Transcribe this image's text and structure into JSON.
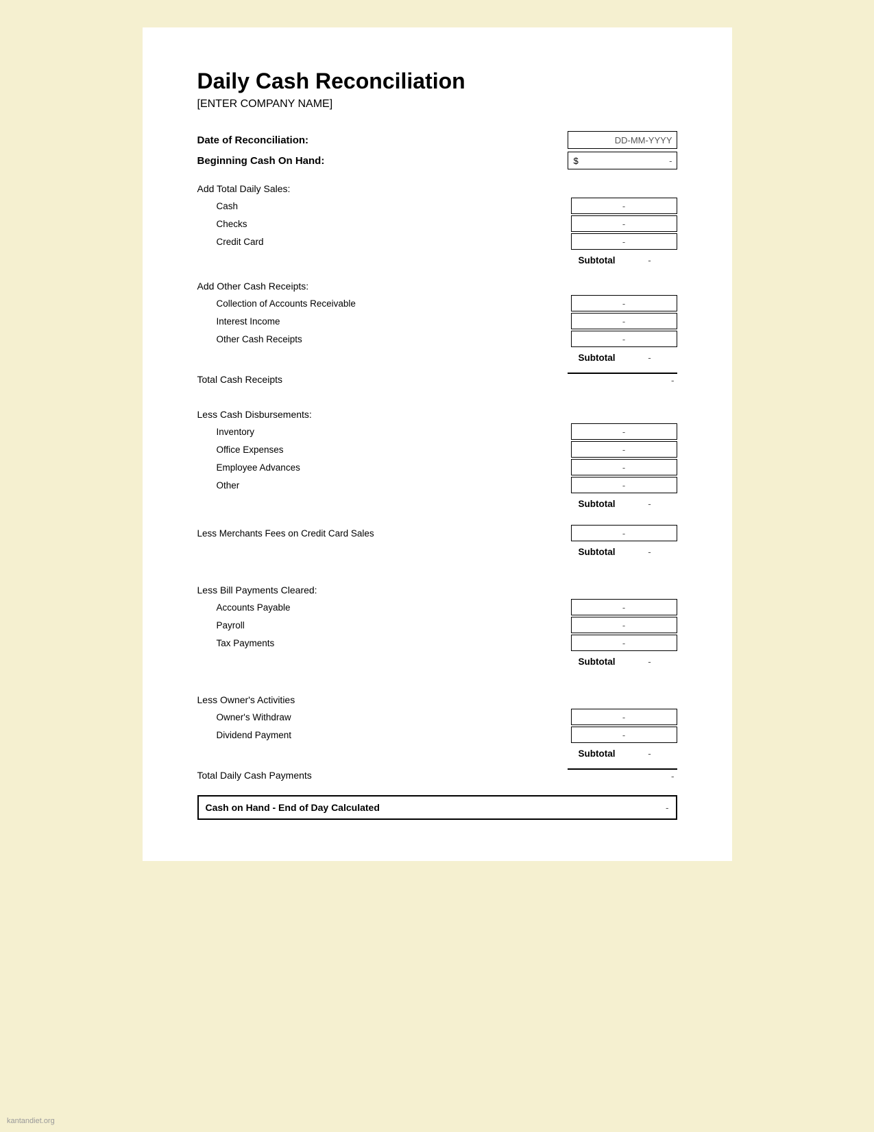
{
  "title": "Daily Cash Reconciliation",
  "company_placeholder": "[ENTER COMPANY NAME]",
  "date_label": "Date of Reconciliation:",
  "date_placeholder": "DD-MM-YYYY",
  "beginning_cash_label": "Beginning Cash On Hand:",
  "beginning_cash_symbol": "$",
  "beginning_cash_value": "-",
  "sections": {
    "daily_sales": {
      "header": "Add Total Daily Sales:",
      "items": [
        {
          "label": "Cash",
          "value": "-"
        },
        {
          "label": "Checks",
          "value": "-"
        },
        {
          "label": "Credit Card",
          "value": "-"
        }
      ],
      "subtotal_label": "Subtotal",
      "subtotal_value": "-"
    },
    "other_receipts": {
      "header": "Add Other Cash Receipts:",
      "items": [
        {
          "label": "Collection of Accounts Receivable",
          "value": "-"
        },
        {
          "label": "Interest Income",
          "value": "-"
        },
        {
          "label": "Other Cash Receipts",
          "value": "-"
        }
      ],
      "subtotal_label": "Subtotal",
      "subtotal_value": "-"
    },
    "total_cash_receipts": {
      "label": "Total Cash Receipts",
      "value": "-"
    },
    "disbursements": {
      "header": "Less Cash Disbursements:",
      "items": [
        {
          "label": "Inventory",
          "value": "-"
        },
        {
          "label": "Office Expenses",
          "value": "-"
        },
        {
          "label": "Employee Advances",
          "value": "-"
        },
        {
          "label": "Other",
          "value": "-"
        }
      ],
      "subtotal_label": "Subtotal",
      "subtotal_value": "-"
    },
    "merchant_fees": {
      "label": "Less Merchants Fees on Credit Card Sales",
      "value": "-",
      "subtotal_label": "Subtotal",
      "subtotal_value": "-"
    },
    "bill_payments": {
      "header": "Less Bill Payments Cleared:",
      "items": [
        {
          "label": "Accounts Payable",
          "value": "-"
        },
        {
          "label": "Payroll",
          "value": "-"
        },
        {
          "label": "Tax Payments",
          "value": "-"
        }
      ],
      "subtotal_label": "Subtotal",
      "subtotal_value": "-"
    },
    "owner_activities": {
      "header": "Less Owner's Activities",
      "items": [
        {
          "label": "Owner's Withdraw",
          "value": "-"
        },
        {
          "label": "Dividend Payment",
          "value": "-"
        }
      ],
      "subtotal_label": "Subtotal",
      "subtotal_value": "-"
    },
    "total_daily_payments": {
      "label": "Total Daily Cash Payments",
      "value": "-"
    },
    "cash_end_of_day": {
      "label": "Cash on Hand - End of Day Calculated",
      "value": "-"
    }
  }
}
